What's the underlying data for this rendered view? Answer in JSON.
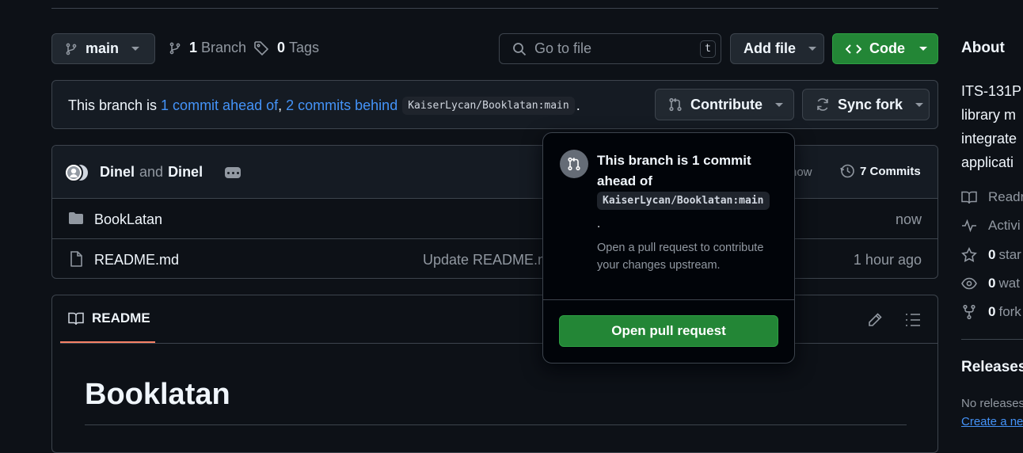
{
  "branch_bar": {
    "branch_name": "main",
    "branches_count": "1",
    "branches_label": "Branch",
    "tags_count": "0",
    "tags_label": "Tags",
    "go_to_file_placeholder": "Go to file",
    "go_to_file_shortcut": "t",
    "add_file_label": "Add file",
    "code_label": "Code"
  },
  "fork_status": {
    "prefix": "This branch is",
    "ahead_link": "1 commit ahead of",
    "comma": ",",
    "behind_link": "2 commits behind",
    "upstream": "KaiserLycan/Booklatan:main",
    "period": ".",
    "contribute_label": "Contribute",
    "sync_fork_label": "Sync fork"
  },
  "commit_bar": {
    "author1": "Dinel",
    "and": "and",
    "author2": "Dinel",
    "time_fragment": "now",
    "commits_label": "7 Commits"
  },
  "files": [
    {
      "name": "BookLatan",
      "type": "folder",
      "message": "",
      "time": "now"
    },
    {
      "name": "README.md",
      "type": "file",
      "message": "Update README.md",
      "time": "1 hour ago"
    }
  ],
  "readme": {
    "tab_label": "README",
    "heading": "Booklatan"
  },
  "popover": {
    "title": "This branch is 1 commit ahead of",
    "upstream": "KaiserLycan/Booklatan:main",
    "period": ".",
    "description": "Open a pull request to contribute your changes upstream.",
    "button_label": "Open pull request"
  },
  "about": {
    "heading": "About",
    "description_lines": [
      "ITS-131P",
      "library m",
      "integrate",
      "applicati"
    ],
    "items": [
      {
        "icon": "book-icon",
        "count": "",
        "label": "Readr"
      },
      {
        "icon": "pulse-icon",
        "count": "",
        "label": "Activi"
      },
      {
        "icon": "star-icon",
        "count": "0",
        "label": "star"
      },
      {
        "icon": "eye-icon",
        "count": "0",
        "label": "wat"
      },
      {
        "icon": "fork-icon",
        "count": "0",
        "label": "fork"
      }
    ],
    "releases_heading": "Releases",
    "no_releases": "No releases",
    "create_link": "Create a new"
  },
  "colors": {
    "background": "#0d1117",
    "green": "#238636",
    "link": "#4493f8",
    "border": "#3d444d"
  }
}
